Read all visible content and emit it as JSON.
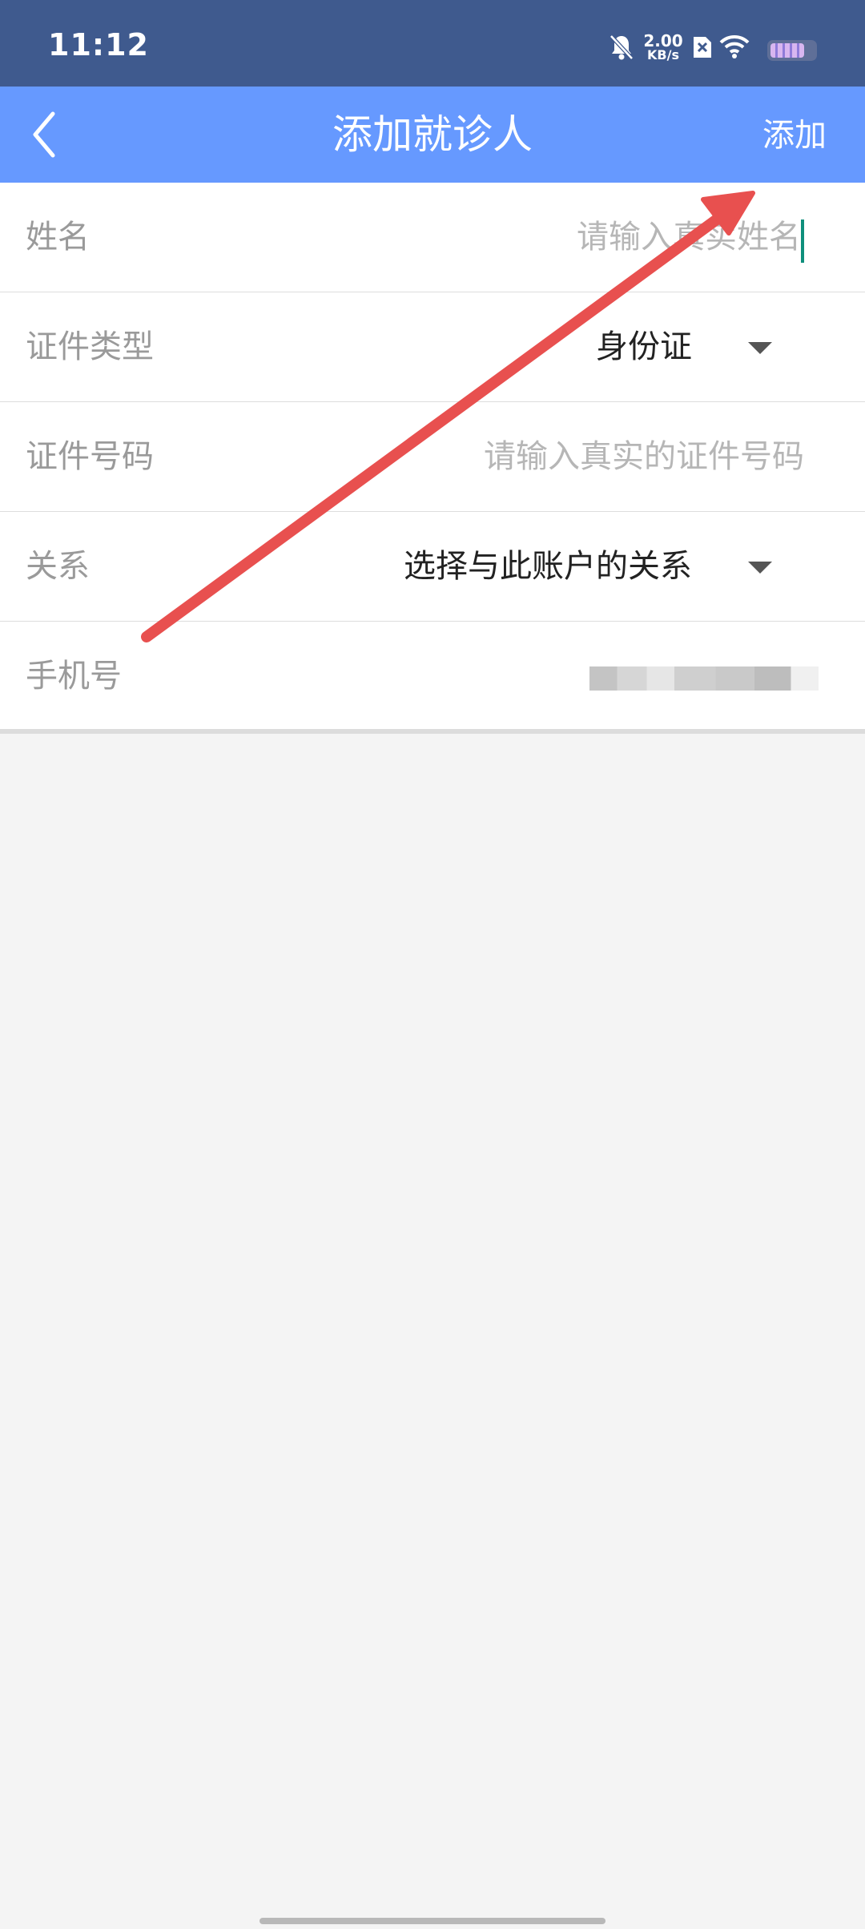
{
  "status_bar": {
    "time": "11:12",
    "net_speed_value": "2.00",
    "net_speed_unit": "KB/s",
    "icons": [
      "bell-off-icon",
      "sim-x-icon",
      "wifi-icon",
      "battery-icon"
    ]
  },
  "app_bar": {
    "back_icon": "chevron-left-icon",
    "title": "添加就诊人",
    "action_label": "添加"
  },
  "form": {
    "name": {
      "label": "姓名",
      "placeholder": "请输入真实姓名"
    },
    "id_type": {
      "label": "证件类型",
      "value": "身份证",
      "icon": "dropdown-arrow-icon"
    },
    "id_number": {
      "label": "证件号码",
      "placeholder": "请输入真实的证件号码"
    },
    "relation": {
      "label": "关系",
      "value": "选择与此账户的关系",
      "icon": "dropdown-arrow-icon"
    },
    "phone": {
      "label": "手机号"
    }
  },
  "colors": {
    "status_bar": "#3f5a8e",
    "app_bar": "#6699ff",
    "background": "#f4f4f4",
    "annotation_arrow": "#e8504f"
  }
}
